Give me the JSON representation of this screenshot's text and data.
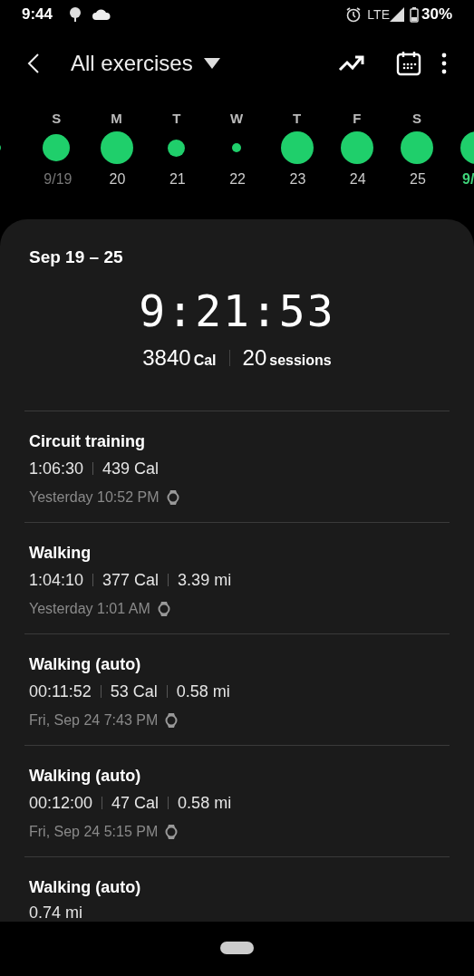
{
  "status_bar": {
    "time": "9:44",
    "network": "LTE",
    "battery": "30%"
  },
  "header": {
    "title": "All exercises"
  },
  "days": [
    {
      "kind": "tiny"
    },
    {
      "letter": "S",
      "date": "9/19",
      "kind": "medium",
      "dimmed": true,
      "selected": false
    },
    {
      "letter": "M",
      "date": "20",
      "kind": "large",
      "dimmed": false,
      "selected": false
    },
    {
      "letter": "T",
      "date": "21",
      "kind": "small",
      "dimmed": false,
      "selected": false
    },
    {
      "letter": "W",
      "date": "22",
      "kind": "tiny",
      "dimmed": false,
      "selected": false
    },
    {
      "letter": "T",
      "date": "23",
      "kind": "large",
      "dimmed": false,
      "selected": false
    },
    {
      "letter": "F",
      "date": "24",
      "kind": "large",
      "dimmed": false,
      "selected": false
    },
    {
      "letter": "S",
      "date": "25",
      "kind": "large",
      "dimmed": false,
      "selected": false
    },
    {
      "date": "9/",
      "kind": "large",
      "selected": true
    }
  ],
  "summary": {
    "range": "Sep 19 – 25",
    "duration": "9:21:53",
    "calories": "3840",
    "calories_unit": "Cal",
    "sessions": "20",
    "sessions_unit": "sessions"
  },
  "exercises": [
    {
      "name": "Circuit training",
      "stats": [
        "1:06:30",
        "439 Cal"
      ],
      "when": "Yesterday 10:52 PM",
      "watch": true
    },
    {
      "name": "Walking",
      "stats": [
        "1:04:10",
        "377 Cal",
        "3.39 mi"
      ],
      "when": "Yesterday 1:01 AM",
      "watch": true
    },
    {
      "name": "Walking (auto)",
      "stats": [
        "00:11:52",
        "53 Cal",
        "0.58 mi"
      ],
      "when": "Fri, Sep 24 7:43 PM",
      "watch": true
    },
    {
      "name": "Walking (auto)",
      "stats": [
        "00:12:00",
        "47 Cal",
        "0.58 mi"
      ],
      "when": "Fri, Sep 24 5:15 PM",
      "watch": true
    },
    {
      "name": "Walking (auto)",
      "stats": [
        "0.74 mi"
      ]
    }
  ]
}
